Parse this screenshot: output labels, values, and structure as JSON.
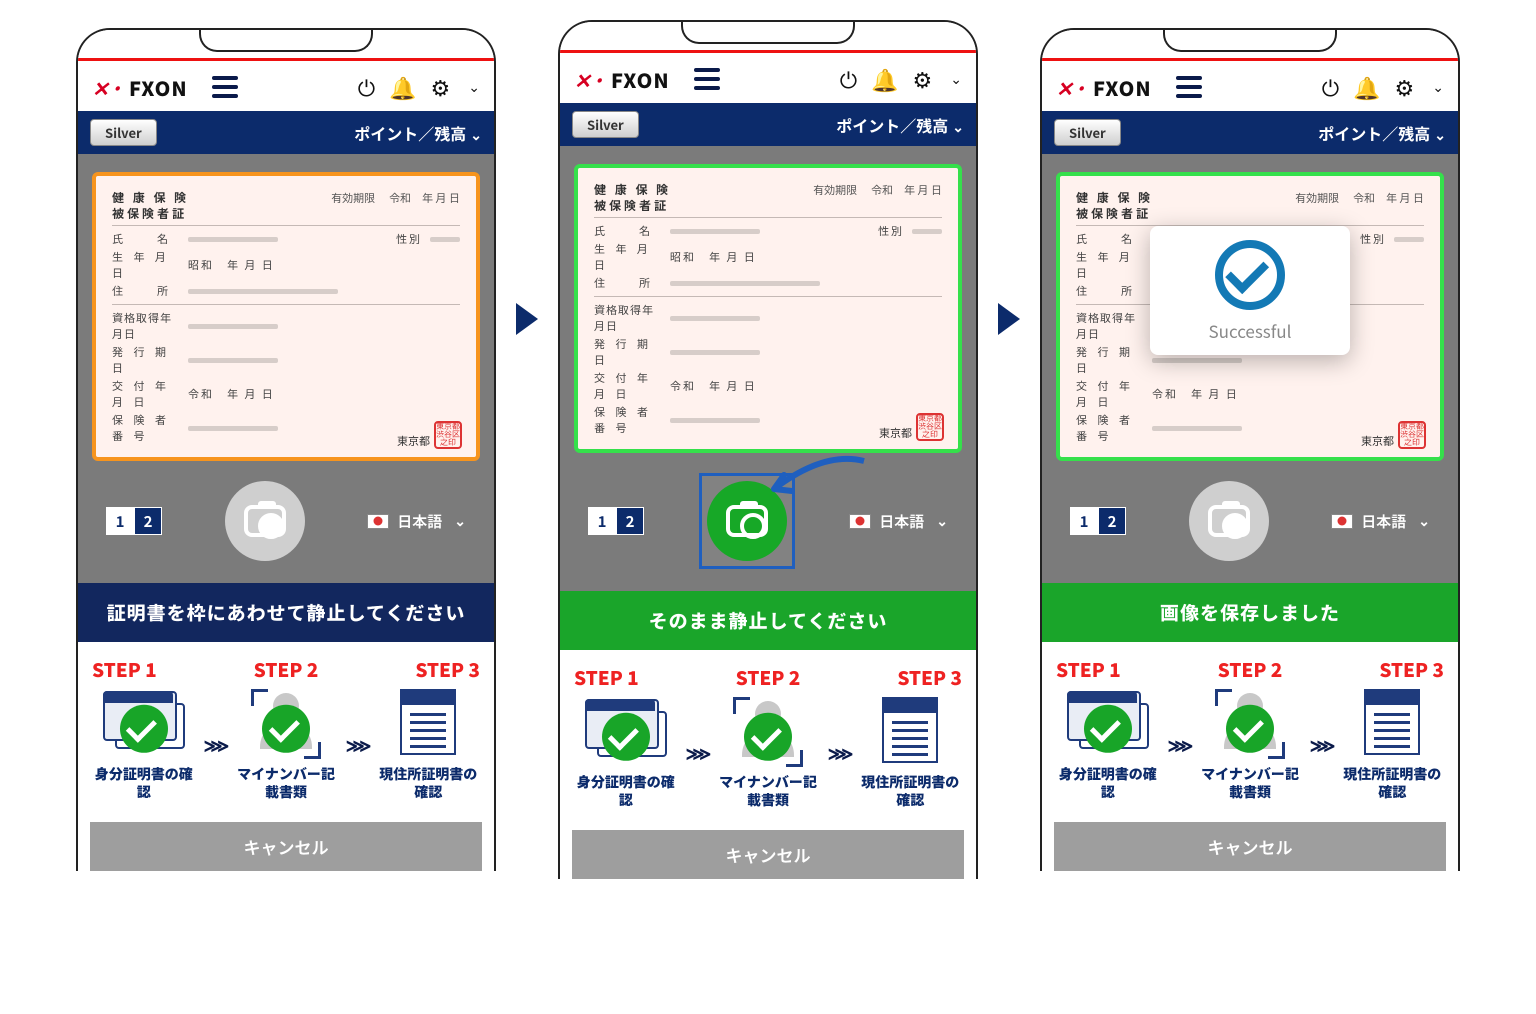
{
  "brand": "FXON",
  "status_tier": "Silver",
  "status_bar_label": "ポイント／残高",
  "language": "日本語",
  "card": {
    "title_l1": "健 康 保 険",
    "title_l2": "被保険者証",
    "exp_label": "有効期限",
    "era": "令和",
    "ymd": "年 月 日",
    "name": "氏　　名",
    "sex": "性別",
    "dob": "生 年 月 日",
    "dob_era": "昭和",
    "addr": "住　　所",
    "qual": "資格取得年月日",
    "issue": "発 行 期 日",
    "deliver": "交 付 年 月 日",
    "insurer": "保 険 者 番 号",
    "city": "東京都",
    "seal": "東京都渋谷区之印"
  },
  "pages": [
    "1",
    "2"
  ],
  "screens": [
    {
      "frame_color": "#f7941d",
      "shutter": "grey",
      "shutter_selected": false,
      "status_text": "証明書を枠にあわせて静止してください",
      "status_style": "navy",
      "curved_arrow": false,
      "popup": false
    },
    {
      "frame_color": "#35e04b",
      "shutter": "green",
      "shutter_selected": true,
      "status_text": "そのまま静止してください",
      "status_style": "green",
      "curved_arrow": true,
      "popup": false
    },
    {
      "frame_color": "#35e04b",
      "shutter": "grey",
      "shutter_selected": false,
      "status_text": "画像を保存しました",
      "status_style": "green",
      "curved_arrow": false,
      "popup": true
    }
  ],
  "popup_text": "Successful",
  "steps": {
    "heads": [
      "STEP 1",
      "STEP 2",
      "STEP 3"
    ],
    "labels": [
      "身分証明書の確認",
      "マイナンバー記載書類",
      "現住所証明書の確認"
    ],
    "arrow": "⋙"
  },
  "cancel": "キャンセル"
}
